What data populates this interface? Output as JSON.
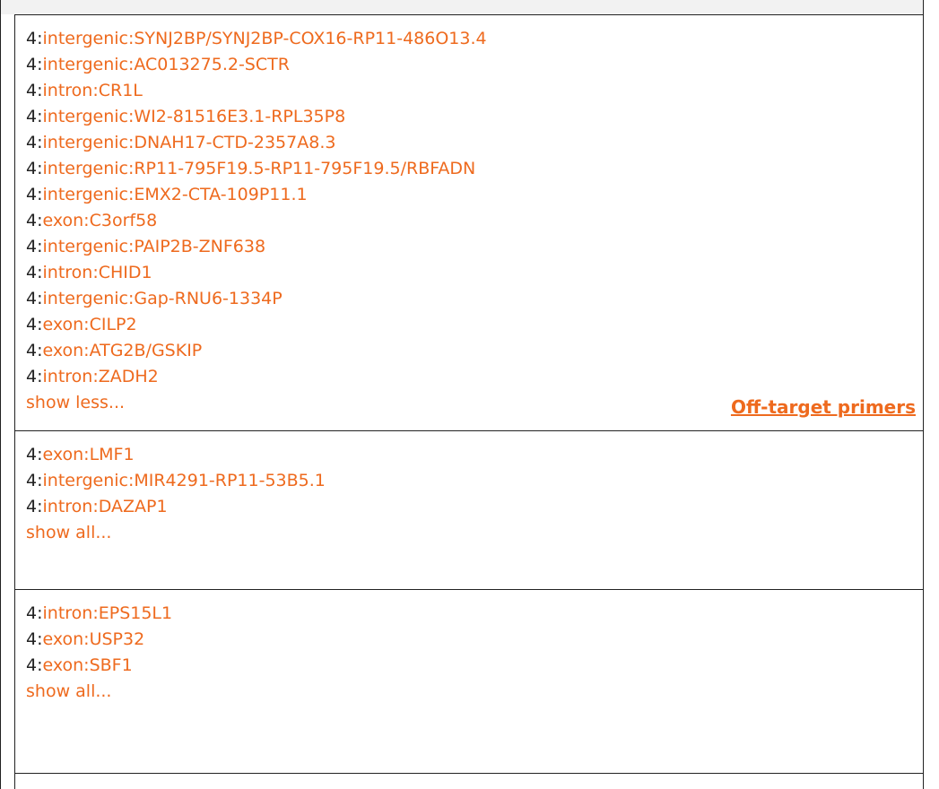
{
  "colors": {
    "accent": "#ee6a1e",
    "text": "#222222",
    "border": "#222222",
    "header_gray": "#f2f2f2"
  },
  "cells": [
    {
      "items": [
        {
          "prefix": "4:",
          "label": "intergenic:SYNJ2BP/SYNJ2BP-COX16-RP11-486O13.4"
        },
        {
          "prefix": "4:",
          "label": "intergenic:AC013275.2-SCTR"
        },
        {
          "prefix": "4:",
          "label": "intron:CR1L"
        },
        {
          "prefix": "4:",
          "label": "intergenic:WI2-81516E3.1-RPL35P8"
        },
        {
          "prefix": "4:",
          "label": "intergenic:DNAH17-CTD-2357A8.3"
        },
        {
          "prefix": "4:",
          "label": "intergenic:RP11-795F19.5-RP11-795F19.5/RBFADN"
        },
        {
          "prefix": "4:",
          "label": "intergenic:EMX2-CTA-109P11.1"
        },
        {
          "prefix": "4:",
          "label": "exon:C3orf58"
        },
        {
          "prefix": "4:",
          "label": "intergenic:PAIP2B-ZNF638"
        },
        {
          "prefix": "4:",
          "label": "intron:CHID1"
        },
        {
          "prefix": "4:",
          "label": "intergenic:Gap-RNU6-1334P"
        },
        {
          "prefix": "4:",
          "label": "exon:CILP2"
        },
        {
          "prefix": "4:",
          "label": "exon:ATG2B/GSKIP"
        },
        {
          "prefix": "4:",
          "label": "intron:ZADH2"
        }
      ],
      "toggle": "show less...",
      "link": "Off-target primers"
    },
    {
      "items": [
        {
          "prefix": "4:",
          "label": "exon:LMF1"
        },
        {
          "prefix": "4:",
          "label": "intergenic:MIR4291-RP11-53B5.1"
        },
        {
          "prefix": "4:",
          "label": "intron:DAZAP1"
        }
      ],
      "toggle": "show all..."
    },
    {
      "items": [
        {
          "prefix": "4:",
          "label": "intron:EPS15L1"
        },
        {
          "prefix": "4:",
          "label": "exon:USP32"
        },
        {
          "prefix": "4:",
          "label": "exon:SBF1"
        }
      ],
      "toggle": "show all..."
    },
    {
      "items": [],
      "toggle": ""
    }
  ]
}
